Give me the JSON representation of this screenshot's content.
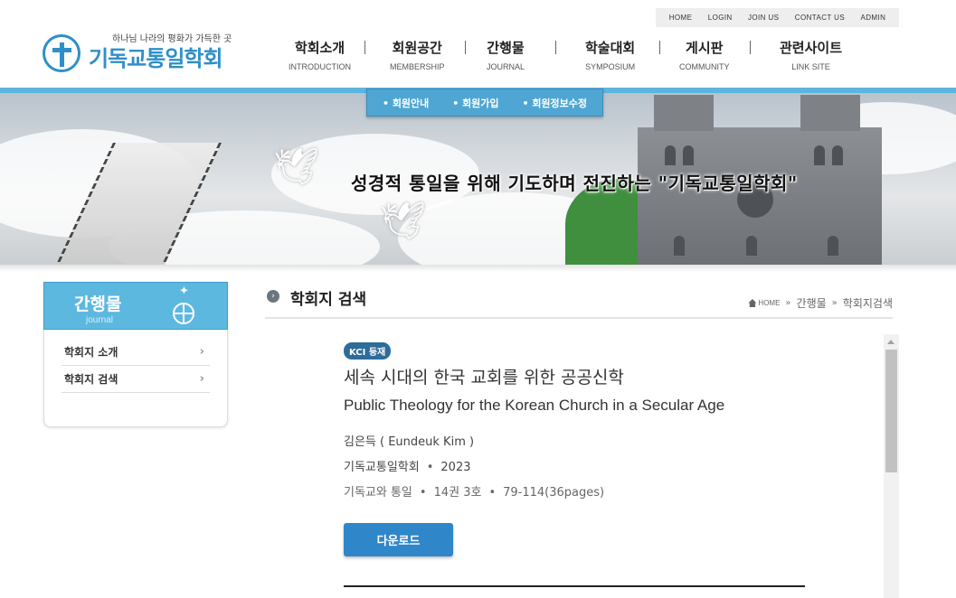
{
  "top_links": [
    "HOME",
    "LOGIN",
    "JOIN US",
    "CONTACT US",
    "ADMIN"
  ],
  "logo": {
    "tagline": "하나님 나라의 평화가 가득한 곳",
    "title": "기독교통일학회"
  },
  "gnb": [
    {
      "ko": "학회소개",
      "en": "INTRODUCTION"
    },
    {
      "ko": "회원공간",
      "en": "MEMBERSHIP"
    },
    {
      "ko": "간행물",
      "en": "JOURNAL"
    },
    {
      "ko": "학술대회",
      "en": "SYMPOSIUM"
    },
    {
      "ko": "게시판",
      "en": "COMMUNITY"
    },
    {
      "ko": "관련사이트",
      "en": "LINK SITE"
    }
  ],
  "subnav": [
    "회원안내",
    "회원가입",
    "회원정보수정"
  ],
  "banner": {
    "slogan": "성경적 통일을 위해 기도하며 전진하는 \"기독교통일학회\""
  },
  "sidebar": {
    "title_ko": "간행물",
    "title_en": "journal",
    "items": [
      {
        "label": "학회지 소개"
      },
      {
        "label": "학회지 검색"
      }
    ]
  },
  "page": {
    "title": "학회지 검색",
    "breadcrumb": {
      "home": "HOME",
      "level1": "간행물",
      "level2": "학회지검색"
    }
  },
  "paper": {
    "badge": "KCI 등재",
    "title_ko": "세속 시대의 한국 교회를 위한 공공신학",
    "title_en": "Public Theology for the Korean Church in a Secular Age",
    "author": "김은득 ( Eundeuk Kim )",
    "publisher": "기독교통일학회",
    "year": "2023",
    "journal": "기독교와 통일",
    "issue": "14권 3호",
    "pages": "79-114(36pages)",
    "download_label": "다운로드"
  },
  "colors": {
    "accent": "#2f8fc8",
    "banner_bar": "#5db4dc",
    "button": "#2f86c9",
    "badge": "#2e6c9a"
  }
}
